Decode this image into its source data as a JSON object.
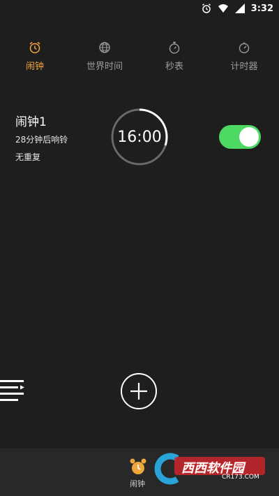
{
  "status_bar": {
    "time": "3:32"
  },
  "tabs": [
    {
      "label": "闹钟",
      "active": true,
      "icon": "alarm-clock-icon"
    },
    {
      "label": "世界时间",
      "active": false,
      "icon": "globe-icon"
    },
    {
      "label": "秒表",
      "active": false,
      "icon": "stopwatch-icon"
    },
    {
      "label": "计时器",
      "active": false,
      "icon": "timer-icon"
    }
  ],
  "alarm": {
    "name": "闹钟1",
    "subtitle": "28分钟后响铃",
    "repeat": "无重复",
    "time": "16:00",
    "enabled": true,
    "progress": 0.3
  },
  "bottom_bar": {
    "label": "闹钟"
  },
  "watermark": {
    "brand": "西西软件园",
    "url": "CR173.COM"
  },
  "colors": {
    "accent": "#f0a63a",
    "toggle_on": "#4cd964",
    "background": "#1e1e1e",
    "inactive_text": "#9a9a9a"
  }
}
